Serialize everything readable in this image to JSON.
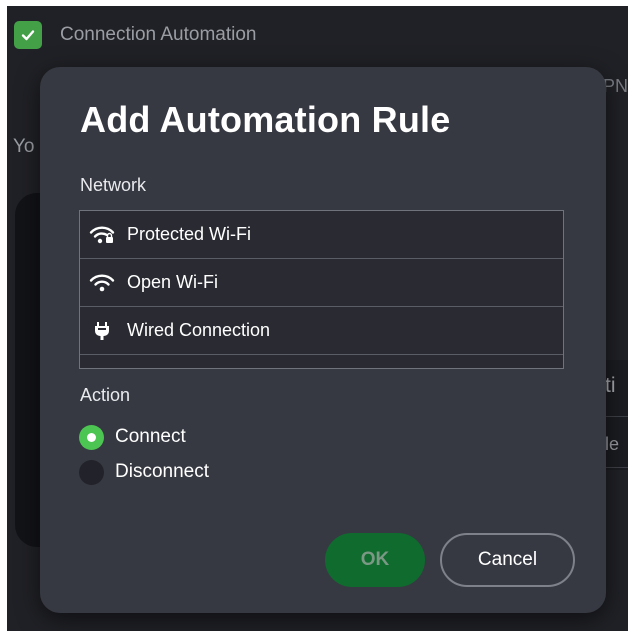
{
  "background": {
    "header_title": "Connection Automation",
    "fragments": {
      "top_right": "PN",
      "left": "Yo",
      "right_heading": "ti",
      "right_cell": "le"
    }
  },
  "dialog": {
    "title": "Add Automation Rule",
    "network_label": "Network",
    "networks": [
      {
        "label": "Protected Wi-Fi",
        "icon": "wifi-lock-icon"
      },
      {
        "label": "Open Wi-Fi",
        "icon": "wifi-icon"
      },
      {
        "label": "Wired Connection",
        "icon": "ethernet-plug-icon"
      }
    ],
    "action_label": "Action",
    "actions": [
      {
        "label": "Connect",
        "selected": true
      },
      {
        "label": "Disconnect",
        "selected": false
      }
    ],
    "buttons": {
      "ok": "OK",
      "cancel": "Cancel"
    }
  },
  "colors": {
    "accent": "#4cc552",
    "ok_button": "#0f6b2e",
    "dialog_bg": "#373942",
    "app_bg": "#202126"
  }
}
